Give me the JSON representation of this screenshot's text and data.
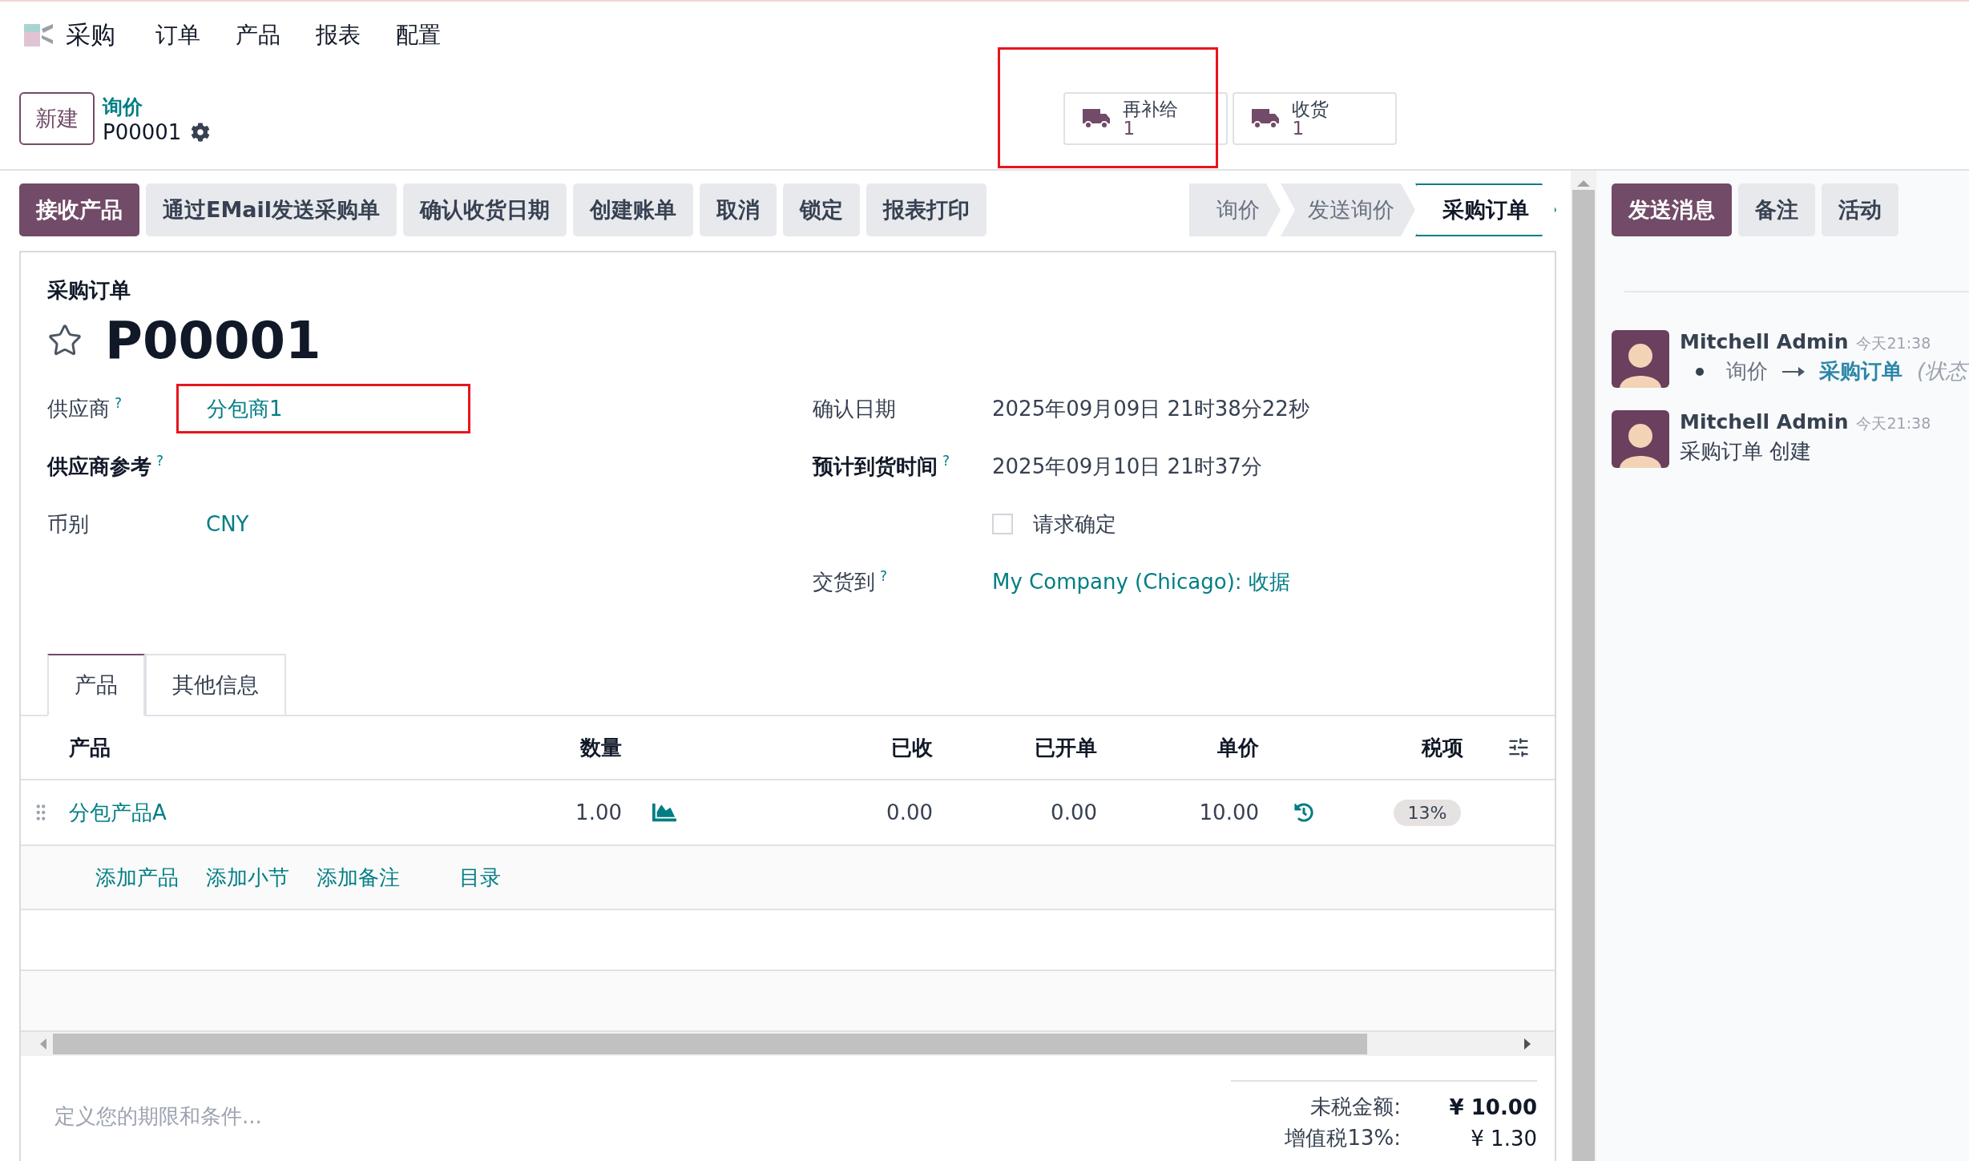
{
  "app": {
    "name": "采购"
  },
  "menu": [
    {
      "label": "订单"
    },
    {
      "label": "产品"
    },
    {
      "label": "报表"
    },
    {
      "label": "配置"
    }
  ],
  "control_panel": {
    "new_button": "新建",
    "breadcrumb_parent": "询价",
    "breadcrumb_current": "P00001",
    "stat_buttons": [
      {
        "label": "再补给",
        "value": "1",
        "highlighted": true
      },
      {
        "label": "收货",
        "value": "1",
        "highlighted": false
      }
    ]
  },
  "actions": [
    {
      "label": "接收产品",
      "kind": "primary"
    },
    {
      "label": "通过EMail发送采购单",
      "kind": "secondary"
    },
    {
      "label": "确认收货日期",
      "kind": "secondary"
    },
    {
      "label": "创建账单",
      "kind": "secondary"
    },
    {
      "label": "取消",
      "kind": "secondary"
    },
    {
      "label": "锁定",
      "kind": "secondary"
    },
    {
      "label": "报表打印",
      "kind": "secondary"
    }
  ],
  "status_steps": [
    {
      "label": "询价",
      "selected": false
    },
    {
      "label": "发送询价",
      "selected": false
    },
    {
      "label": "采购订单",
      "selected": true
    }
  ],
  "form": {
    "subtitle": "采购订单",
    "title": "P00001",
    "starred": false,
    "left_fields": [
      {
        "label": "供应商",
        "help": "?",
        "required": false,
        "kind": "link",
        "value": "分包商1",
        "highlighted": true
      },
      {
        "label": "供应商参考",
        "help": "?",
        "required": true,
        "kind": "empty"
      },
      {
        "label": "币别",
        "required": false,
        "kind": "link",
        "value": "CNY"
      }
    ],
    "right_fields": [
      {
        "label": "确认日期",
        "required": false,
        "kind": "text",
        "value": "2025年09月09日 21时38分22秒"
      },
      {
        "label": "预计到货时间",
        "help": "?",
        "required": true,
        "kind": "text",
        "value": "2025年09月10日 21时37分"
      },
      {
        "kind": "checkbox",
        "value": "请求确定",
        "checked": false
      },
      {
        "label": "交货到",
        "help": "?",
        "required": false,
        "kind": "link",
        "value": "My Company (Chicago): 收据"
      }
    ]
  },
  "tabs": [
    {
      "label": "产品",
      "selected": true
    },
    {
      "label": "其他信息",
      "selected": false
    }
  ],
  "table": {
    "columns": [
      "产品",
      "数量",
      "已收",
      "已开单",
      "单价",
      "税项"
    ],
    "rows": [
      {
        "product": "分包产品A",
        "quantity": "1.00",
        "received": "0.00",
        "billed": "0.00",
        "unit_price": "10.00",
        "tax": "13%"
      }
    ],
    "add_links": [
      "添加产品",
      "添加小节",
      "添加备注",
      "目录"
    ]
  },
  "terms": {
    "placeholder": "定义您的期限和条件..."
  },
  "totals": [
    {
      "label": "未税金额:",
      "value": "¥ 10.00",
      "bold": true
    },
    {
      "label": "增值税13%:",
      "value": "¥ 1.30",
      "bold": false
    }
  ],
  "chatter": {
    "buttons": [
      {
        "label": "发送消息",
        "kind": "primary"
      },
      {
        "label": "备注",
        "kind": "secondary"
      },
      {
        "label": "活动",
        "kind": "secondary"
      }
    ],
    "messages": [
      {
        "author": "Mitchell Admin",
        "time": "今天21:38",
        "kind": "tracking",
        "old_value": "询价",
        "new_value": "采购订单",
        "field": "(状态"
      },
      {
        "author": "Mitchell Admin",
        "time": "今天21:38",
        "kind": "text",
        "body": "采购订单 创建"
      }
    ]
  }
}
